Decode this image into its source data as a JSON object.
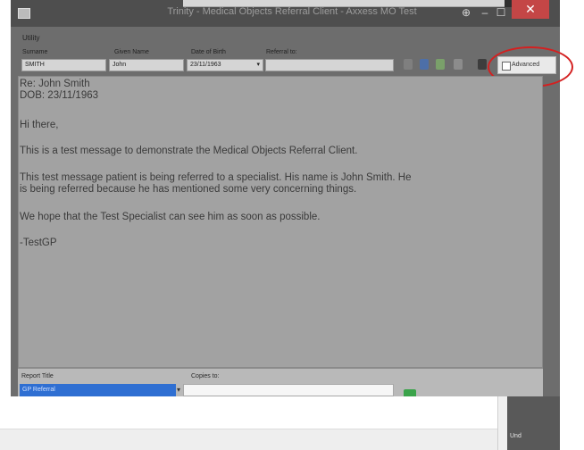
{
  "window": {
    "title": "Trinity - Medical Objects Referral Client - Axxess MO Test",
    "minimize": "–",
    "maximize": "☐",
    "close": "✕",
    "pin": "⊕"
  },
  "menu": {
    "utility": "Utility"
  },
  "fields": {
    "surname_label": "Surname",
    "surname_value": "SMITH",
    "given_name_label": "Given Name",
    "given_name_value": "John",
    "dob_label": "Date of Birth",
    "dob_value": "23/11/1963",
    "referral_to_label": "Referral to:",
    "referral_to_value": ""
  },
  "toolbar": {
    "icons": [
      "pin-icon",
      "person-icon",
      "document-icon",
      "upload-icon",
      "print-icon"
    ],
    "advanced_label": "Advanced"
  },
  "document": {
    "lines": [
      "Re: John Smith",
      "DOB: 23/11/1963",
      "Hi there,",
      "This is a test message to demonstrate the Medical Objects Referral Client.",
      "This test message patient is being referred to a specialist. His name is John Smith. He",
      "is being referred because he has mentioned some very concerning things.",
      "We hope that the Test Specialist can see him as soon as possible.",
      "-TestGP"
    ]
  },
  "bottom": {
    "report_title_label": "Report Title",
    "report_title_value": "GP Referral",
    "copies_to_label": "Copies to:"
  },
  "overlay": {
    "right_text": "Und"
  },
  "colors": {
    "close": "#c44646",
    "selected": "#2f6fd2",
    "highlight_circle": "#d42020",
    "add": "#3aa34a"
  }
}
